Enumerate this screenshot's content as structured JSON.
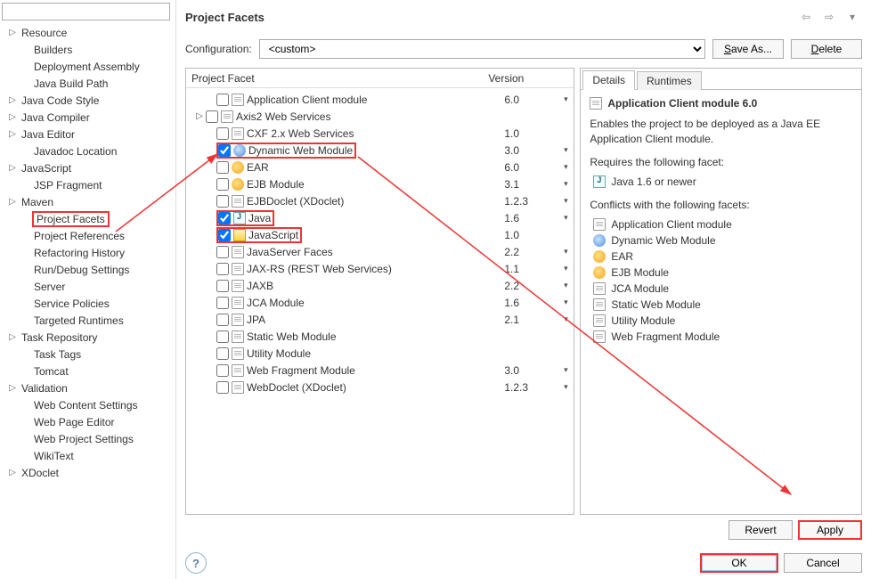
{
  "header": {
    "title": "Project Facets"
  },
  "sidebar": {
    "filter_placeholder": "",
    "items": [
      {
        "label": "Resource",
        "expandable": true,
        "depth": 1
      },
      {
        "label": "Builders",
        "expandable": false,
        "depth": 2
      },
      {
        "label": "Deployment Assembly",
        "expandable": false,
        "depth": 2
      },
      {
        "label": "Java Build Path",
        "expandable": false,
        "depth": 2
      },
      {
        "label": "Java Code Style",
        "expandable": true,
        "depth": 1
      },
      {
        "label": "Java Compiler",
        "expandable": true,
        "depth": 1
      },
      {
        "label": "Java Editor",
        "expandable": true,
        "depth": 1
      },
      {
        "label": "Javadoc Location",
        "expandable": false,
        "depth": 2
      },
      {
        "label": "JavaScript",
        "expandable": true,
        "depth": 1
      },
      {
        "label": "JSP Fragment",
        "expandable": false,
        "depth": 2
      },
      {
        "label": "Maven",
        "expandable": true,
        "depth": 1
      },
      {
        "label": "Project Facets",
        "expandable": false,
        "depth": 2,
        "selected": true
      },
      {
        "label": "Project References",
        "expandable": false,
        "depth": 2
      },
      {
        "label": "Refactoring History",
        "expandable": false,
        "depth": 2
      },
      {
        "label": "Run/Debug Settings",
        "expandable": false,
        "depth": 2
      },
      {
        "label": "Server",
        "expandable": false,
        "depth": 2
      },
      {
        "label": "Service Policies",
        "expandable": false,
        "depth": 2
      },
      {
        "label": "Targeted Runtimes",
        "expandable": false,
        "depth": 2
      },
      {
        "label": "Task Repository",
        "expandable": true,
        "depth": 1
      },
      {
        "label": "Task Tags",
        "expandable": false,
        "depth": 2
      },
      {
        "label": "Tomcat",
        "expandable": false,
        "depth": 2
      },
      {
        "label": "Validation",
        "expandable": true,
        "depth": 1
      },
      {
        "label": "Web Content Settings",
        "expandable": false,
        "depth": 2
      },
      {
        "label": "Web Page Editor",
        "expandable": false,
        "depth": 2
      },
      {
        "label": "Web Project Settings",
        "expandable": false,
        "depth": 2
      },
      {
        "label": "WikiText",
        "expandable": false,
        "depth": 2
      },
      {
        "label": "XDoclet",
        "expandable": true,
        "depth": 1
      }
    ]
  },
  "config": {
    "label": "Configuration:",
    "selected": "<custom>",
    "save_as": "Save As...",
    "delete": "Delete"
  },
  "facets": {
    "col_facet": "Project Facet",
    "col_version": "Version",
    "rows": [
      {
        "name": "Application Client module",
        "version": "6.0",
        "checked": false,
        "expandable": false,
        "depth": 1,
        "arrow": true
      },
      {
        "name": "Axis2 Web Services",
        "version": "",
        "checked": false,
        "expandable": true,
        "depth": 0,
        "arrow": false
      },
      {
        "name": "CXF 2.x Web Services",
        "version": "1.0",
        "checked": false,
        "expandable": false,
        "depth": 1,
        "arrow": false
      },
      {
        "name": "Dynamic Web Module",
        "version": "3.0",
        "checked": true,
        "expandable": false,
        "depth": 1,
        "arrow": true,
        "highlight": true,
        "icon": "dwm"
      },
      {
        "name": "EAR",
        "version": "6.0",
        "checked": false,
        "expandable": false,
        "depth": 1,
        "arrow": true,
        "icon": "ear"
      },
      {
        "name": "EJB Module",
        "version": "3.1",
        "checked": false,
        "expandable": false,
        "depth": 1,
        "arrow": true,
        "icon": "ear"
      },
      {
        "name": "EJBDoclet (XDoclet)",
        "version": "1.2.3",
        "checked": false,
        "expandable": false,
        "depth": 1,
        "arrow": true
      },
      {
        "name": "Java",
        "version": "1.6",
        "checked": true,
        "expandable": false,
        "depth": 1,
        "arrow": true,
        "highlight": true,
        "icon": "java"
      },
      {
        "name": "JavaScript",
        "version": "1.0",
        "checked": true,
        "expandable": false,
        "depth": 1,
        "arrow": false,
        "highlight": true,
        "icon": "js"
      },
      {
        "name": "JavaServer Faces",
        "version": "2.2",
        "checked": false,
        "expandable": false,
        "depth": 1,
        "arrow": true
      },
      {
        "name": "JAX-RS (REST Web Services)",
        "version": "1.1",
        "checked": false,
        "expandable": false,
        "depth": 1,
        "arrow": true
      },
      {
        "name": "JAXB",
        "version": "2.2",
        "checked": false,
        "expandable": false,
        "depth": 1,
        "arrow": true
      },
      {
        "name": "JCA Module",
        "version": "1.6",
        "checked": false,
        "expandable": false,
        "depth": 1,
        "arrow": true
      },
      {
        "name": "JPA",
        "version": "2.1",
        "checked": false,
        "expandable": false,
        "depth": 1,
        "arrow": true
      },
      {
        "name": "Static Web Module",
        "version": "",
        "checked": false,
        "expandable": false,
        "depth": 1,
        "arrow": false
      },
      {
        "name": "Utility Module",
        "version": "",
        "checked": false,
        "expandable": false,
        "depth": 1,
        "arrow": false
      },
      {
        "name": "Web Fragment Module",
        "version": "3.0",
        "checked": false,
        "expandable": false,
        "depth": 1,
        "arrow": true
      },
      {
        "name": "WebDoclet (XDoclet)",
        "version": "1.2.3",
        "checked": false,
        "expandable": false,
        "depth": 1,
        "arrow": true
      }
    ]
  },
  "details": {
    "tab_details": "Details",
    "tab_runtimes": "Runtimes",
    "title": "Application Client module 6.0",
    "desc": "Enables the project to be deployed as a Java EE Application Client module.",
    "requires_label": "Requires the following facet:",
    "requires": [
      {
        "label": "Java 1.6 or newer",
        "icon": "java"
      }
    ],
    "conflicts_label": "Conflicts with the following facets:",
    "conflicts": [
      {
        "label": "Application Client module",
        "icon": "doc"
      },
      {
        "label": "Dynamic Web Module",
        "icon": "dwm"
      },
      {
        "label": "EAR",
        "icon": "ear"
      },
      {
        "label": "EJB Module",
        "icon": "ear"
      },
      {
        "label": "JCA Module",
        "icon": "doc"
      },
      {
        "label": "Static Web Module",
        "icon": "doc"
      },
      {
        "label": "Utility Module",
        "icon": "doc"
      },
      {
        "label": "Web Fragment Module",
        "icon": "doc"
      }
    ]
  },
  "buttons": {
    "revert": "Revert",
    "apply": "Apply",
    "ok": "OK",
    "cancel": "Cancel"
  }
}
